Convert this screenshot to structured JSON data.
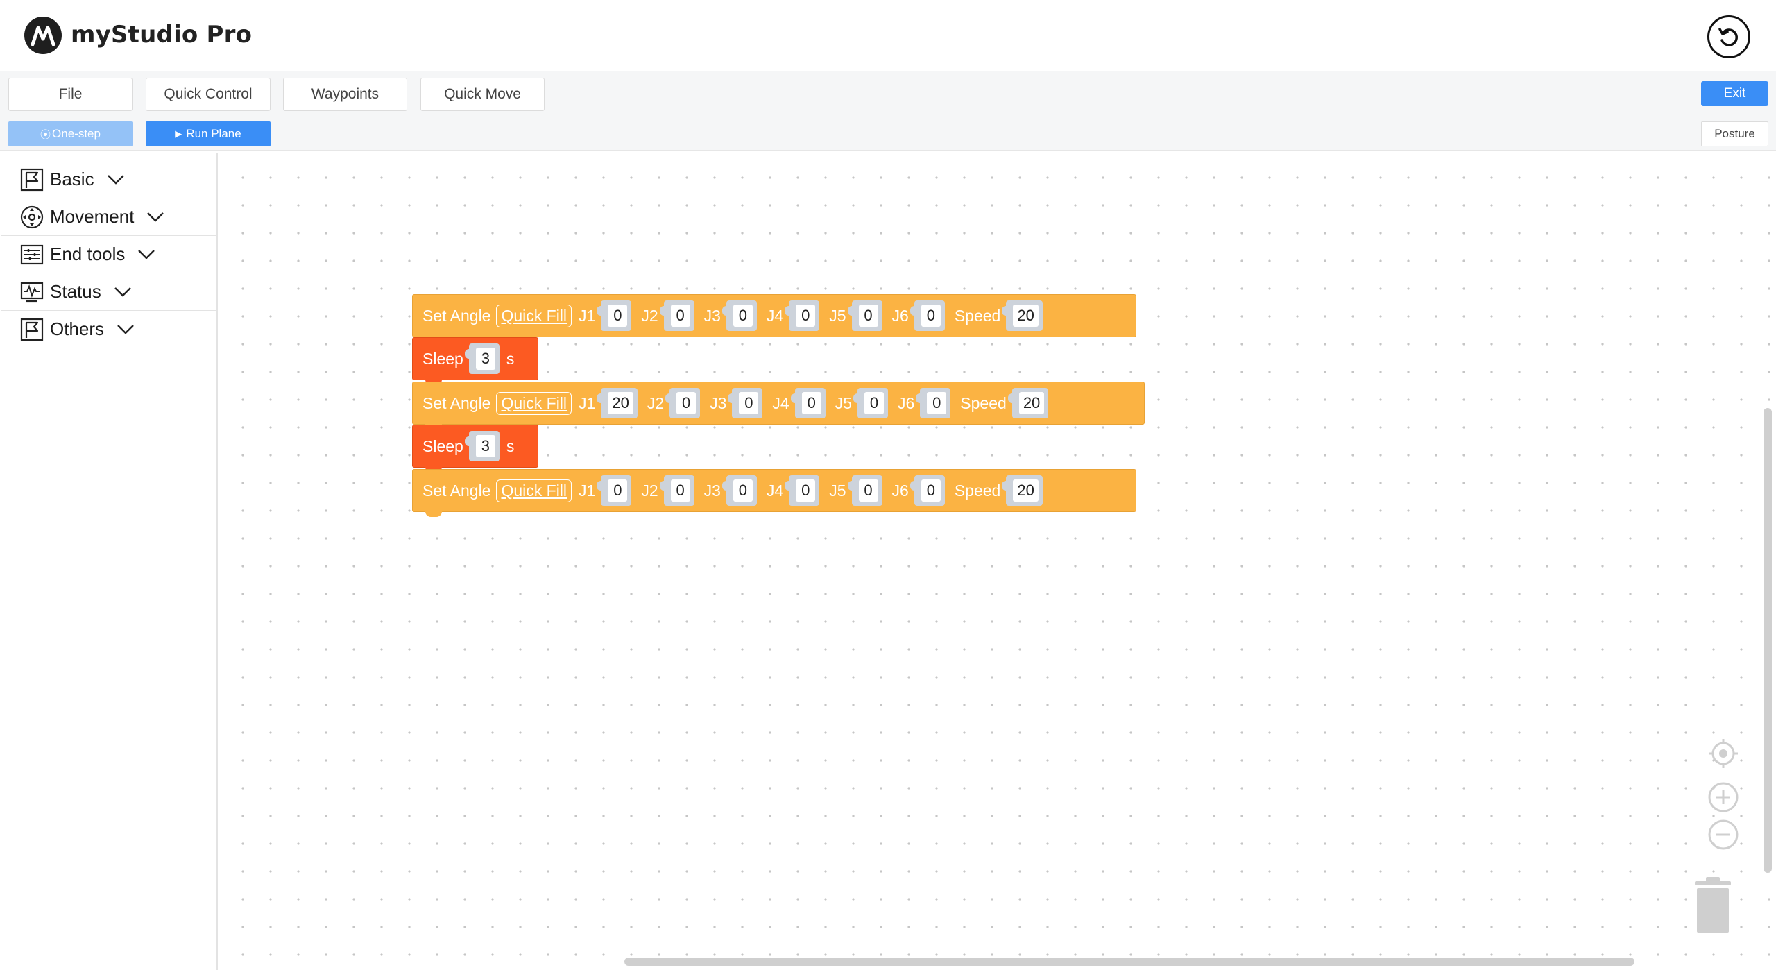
{
  "app": {
    "title": "myStudio Pro"
  },
  "menu": {
    "file": "File",
    "quick_control": "Quick Control",
    "waypoints": "Waypoints",
    "quick_move": "Quick Move",
    "exit": "Exit",
    "posture": "Posture"
  },
  "run": {
    "one_step": "One-step",
    "run_plane": "Run Plane"
  },
  "sidebar": {
    "categories": [
      {
        "label": "Basic",
        "icon": "flag-icon"
      },
      {
        "label": "Movement",
        "icon": "move-icon"
      },
      {
        "label": "End tools",
        "icon": "tools-icon"
      },
      {
        "label": "Status",
        "icon": "status-icon"
      },
      {
        "label": "Others",
        "icon": "flag-icon"
      }
    ]
  },
  "blocks": {
    "set_angle_label": "Set Angle",
    "quick_fill_label": "Quick Fill",
    "speed_label": "Speed",
    "sleep_label": "Sleep",
    "sleep_unit": "s",
    "joint_labels": [
      "J1",
      "J2",
      "J3",
      "J4",
      "J5",
      "J6"
    ],
    "program": [
      {
        "type": "set_angle",
        "values": [
          "0",
          "0",
          "0",
          "0",
          "0",
          "0"
        ],
        "speed": "20"
      },
      {
        "type": "sleep",
        "value": "3"
      },
      {
        "type": "set_angle",
        "values": [
          "20",
          "0",
          "0",
          "0",
          "0",
          "0"
        ],
        "speed": "20"
      },
      {
        "type": "sleep",
        "value": "3"
      },
      {
        "type": "set_angle",
        "values": [
          "0",
          "0",
          "0",
          "0",
          "0",
          "0"
        ],
        "speed": "20"
      }
    ]
  },
  "colors": {
    "accent": "#3a8ef6",
    "set_angle_block": "#fbb343",
    "sleep_block": "#fc5a22"
  }
}
